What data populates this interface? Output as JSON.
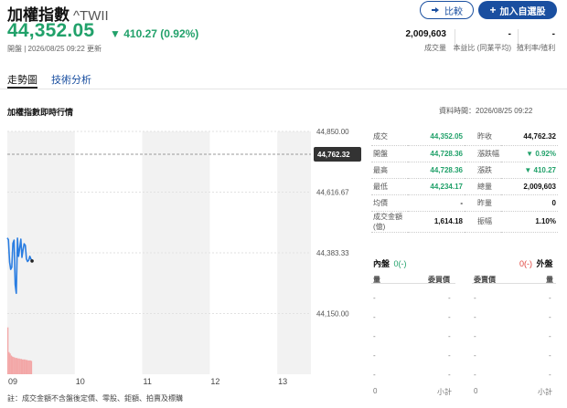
{
  "header": {
    "title": "加權指數",
    "symbol": "^TWII",
    "compare_label": "比較",
    "add_watchlist_label": "加入自選股"
  },
  "quote": {
    "price": "44,352.05",
    "change": "410.27 (0.92%)",
    "change_direction": "up",
    "updated": "開盤 | 2026/08/25 09:22 更新"
  },
  "stats": [
    {
      "value": "2,009,603",
      "label": "成交量"
    },
    {
      "value": "-",
      "label": "本益比 (同業平均)"
    },
    {
      "value": "-",
      "label": "殖利率/殖利"
    }
  ],
  "tabs": [
    {
      "label": "走勢圖",
      "active": true
    },
    {
      "label": "技術分析",
      "active": false
    }
  ],
  "section": {
    "title": "加權指數即時行情",
    "data_time": "資料時間：2026/08/25 09:22"
  },
  "chart_data": {
    "type": "line",
    "x_ticks": [
      "09",
      "10",
      "11",
      "12",
      "13"
    ],
    "y_ticks": [
      "44,850.00",
      "44,616.67",
      "44,383.33",
      "44,150.00"
    ],
    "reference_label": "44,762.32",
    "reference_value": 44762.32,
    "ylim": [
      43916.67,
      44850
    ],
    "x_range_minutes": [
      0,
      270
    ],
    "price_series": [
      {
        "t": 0,
        "v": 44441
      },
      {
        "t": 1,
        "v": 44433
      },
      {
        "t": 2,
        "v": 44348
      },
      {
        "t": 3,
        "v": 44320
      },
      {
        "t": 4,
        "v": 44328
      },
      {
        "t": 5,
        "v": 44420
      },
      {
        "t": 6,
        "v": 44432
      },
      {
        "t": 7,
        "v": 44262
      },
      {
        "t": 8,
        "v": 44228
      },
      {
        "t": 9,
        "v": 44440
      },
      {
        "t": 10,
        "v": 44370
      },
      {
        "t": 11,
        "v": 44400
      },
      {
        "t": 12,
        "v": 44436
      },
      {
        "t": 13,
        "v": 44366
      },
      {
        "t": 14,
        "v": 44395
      },
      {
        "t": 15,
        "v": 44418
      },
      {
        "t": 16,
        "v": 44412
      },
      {
        "t": 17,
        "v": 44360
      },
      {
        "t": 18,
        "v": 44350
      },
      {
        "t": 19,
        "v": 44355
      },
      {
        "t": 20,
        "v": 44370
      },
      {
        "t": 21,
        "v": 44360
      },
      {
        "t": 22,
        "v": 44352
      }
    ],
    "volume_series": [
      0.95,
      0.45,
      0.42,
      0.38,
      0.36,
      0.35,
      0.34,
      0.33,
      0.33,
      0.32,
      0.32,
      0.31,
      0.31,
      0.3,
      0.3,
      0.3,
      0.29,
      0.29,
      0.28,
      0.28,
      0.28,
      0.27
    ],
    "colors": {
      "line": "#2a7de1",
      "volume": "#f3a6a6",
      "shade": "#f2f2f2",
      "badge": "#333333"
    }
  },
  "quote_table": [
    {
      "l1": "成交",
      "v1": "44,352.05",
      "c1": "up",
      "l2": "昨收",
      "v2": "44,762.32",
      "c2": ""
    },
    {
      "l1": "開盤",
      "v1": "44,728.36",
      "c1": "up",
      "l2": "漲跌幅",
      "v2": "▼ 0.92%",
      "c2": "up"
    },
    {
      "l1": "最高",
      "v1": "44,728.36",
      "c1": "up",
      "l2": "漲跌",
      "v2": "▼ 410.27",
      "c2": "up"
    },
    {
      "l1": "最低",
      "v1": "44,234.17",
      "c1": "up",
      "l2": "總量",
      "v2": "2,009,603",
      "c2": ""
    },
    {
      "l1": "均價",
      "v1": "-",
      "c1": "",
      "l2": "昨量",
      "v2": "0",
      "c2": ""
    },
    {
      "l1": "成交金額(億)",
      "v1": "1,614.18",
      "c1": "",
      "l2": "振幅",
      "v2": "1.10%",
      "c2": ""
    }
  ],
  "order_book": {
    "inner_label": "內盤",
    "inner_value": "0(-)",
    "outer_label": "外盤",
    "outer_value": "0(-)",
    "col_qty": "量",
    "col_buy": "委買價",
    "col_sell": "委賣價",
    "col_qty2": "量",
    "rows": [
      [
        "-",
        "-",
        "-",
        "-"
      ],
      [
        "-",
        "-",
        "-",
        "-"
      ],
      [
        "-",
        "-",
        "-",
        "-"
      ],
      [
        "-",
        "-",
        "-",
        "-"
      ],
      [
        "-",
        "-",
        "-",
        "-"
      ]
    ],
    "total_left": "0",
    "subtotal_left": "小計",
    "total_right": "0",
    "subtotal_right": "小計"
  },
  "note": "註：成交金額不含盤後定價、零股、鉅額、拍賣及標購"
}
